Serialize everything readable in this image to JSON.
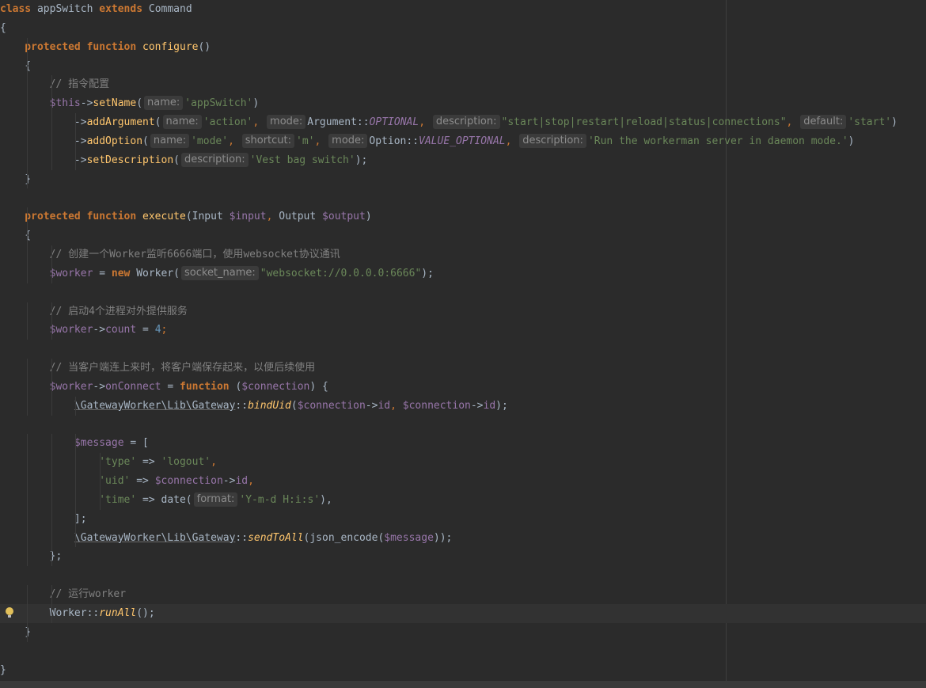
{
  "editor": {
    "lines": [
      [
        {
          "t": "class ",
          "c": "kw"
        },
        {
          "t": "appSwitch ",
          "c": "plain"
        },
        {
          "t": "extends ",
          "c": "kw"
        },
        {
          "t": "Command",
          "c": "plain"
        }
      ],
      [
        {
          "t": "{",
          "c": "plain"
        }
      ],
      [
        {
          "t": "    protected ",
          "c": "kw"
        },
        {
          "t": "function ",
          "c": "kw"
        },
        {
          "t": "configure",
          "c": "fn"
        },
        {
          "t": "()",
          "c": "plain"
        }
      ],
      [
        {
          "t": "    {",
          "c": "plain"
        }
      ],
      [
        {
          "t": "        // 指令配置",
          "c": "cm"
        }
      ],
      [
        {
          "t": "        $this",
          "c": "var"
        },
        {
          "t": "->",
          "c": "plain"
        },
        {
          "t": "setName",
          "c": "fn"
        },
        {
          "t": "(",
          "c": "plain"
        },
        {
          "h": "name:"
        },
        {
          "t": "'appSwitch'",
          "c": "str"
        },
        {
          "t": ")",
          "c": "plain"
        }
      ],
      [
        {
          "t": "            ->",
          "c": "plain"
        },
        {
          "t": "addArgument",
          "c": "fn"
        },
        {
          "t": "(",
          "c": "plain"
        },
        {
          "h": "name:"
        },
        {
          "t": "'action'",
          "c": "str"
        },
        {
          "t": ", ",
          "c": "kwp"
        },
        {
          "h": "mode:"
        },
        {
          "t": "Argument::",
          "c": "plain"
        },
        {
          "t": "OPTIONAL",
          "c": "const"
        },
        {
          "t": ", ",
          "c": "kwp"
        },
        {
          "h": "description:"
        },
        {
          "t": "\"start|stop|restart|reload|status|connections\"",
          "c": "str"
        },
        {
          "t": ", ",
          "c": "kwp"
        },
        {
          "h": "default:"
        },
        {
          "t": "'start'",
          "c": "str"
        },
        {
          "t": ")",
          "c": "plain"
        }
      ],
      [
        {
          "t": "            ->",
          "c": "plain"
        },
        {
          "t": "addOption",
          "c": "fn"
        },
        {
          "t": "(",
          "c": "plain"
        },
        {
          "h": "name:"
        },
        {
          "t": "'mode'",
          "c": "str"
        },
        {
          "t": ", ",
          "c": "kwp"
        },
        {
          "h": "shortcut:"
        },
        {
          "t": "'m'",
          "c": "str"
        },
        {
          "t": ", ",
          "c": "kwp"
        },
        {
          "h": "mode:"
        },
        {
          "t": "Option::",
          "c": "plain"
        },
        {
          "t": "VALUE_OPTIONAL",
          "c": "const"
        },
        {
          "t": ", ",
          "c": "kwp"
        },
        {
          "h": "description:"
        },
        {
          "t": "'Run the workerman server in daemon mode.'",
          "c": "str"
        },
        {
          "t": ")",
          "c": "plain"
        }
      ],
      [
        {
          "t": "            ->",
          "c": "plain"
        },
        {
          "t": "setDescription",
          "c": "fn"
        },
        {
          "t": "(",
          "c": "plain"
        },
        {
          "h": "description:"
        },
        {
          "t": "'Vest bag switch'",
          "c": "str"
        },
        {
          "t": ");",
          "c": "plain"
        }
      ],
      [
        {
          "t": "    }",
          "c": "plain"
        }
      ],
      [],
      [
        {
          "t": "    protected ",
          "c": "kw"
        },
        {
          "t": "function ",
          "c": "kw"
        },
        {
          "t": "execute",
          "c": "fn"
        },
        {
          "t": "(Input ",
          "c": "plain"
        },
        {
          "t": "$input",
          "c": "var"
        },
        {
          "t": ", ",
          "c": "kwp"
        },
        {
          "t": "Output ",
          "c": "plain"
        },
        {
          "t": "$output",
          "c": "var"
        },
        {
          "t": ")",
          "c": "plain"
        }
      ],
      [
        {
          "t": "    {",
          "c": "plain"
        }
      ],
      [
        {
          "t": "        // 创建一个Worker监听6666端口，使用websocket协议通讯",
          "c": "cm"
        }
      ],
      [
        {
          "t": "        $worker",
          "c": "var"
        },
        {
          "t": " = ",
          "c": "plain"
        },
        {
          "t": "new ",
          "c": "kw"
        },
        {
          "t": "Worker(",
          "c": "plain"
        },
        {
          "h": "socket_name:"
        },
        {
          "t": "\"websocket://0.0.0.0:6666\"",
          "c": "str"
        },
        {
          "t": ");",
          "c": "plain"
        }
      ],
      [],
      [
        {
          "t": "        // 启动4个进程对外提供服务",
          "c": "cm"
        }
      ],
      [
        {
          "t": "        $worker",
          "c": "var"
        },
        {
          "t": "->",
          "c": "plain"
        },
        {
          "t": "count",
          "c": "var"
        },
        {
          "t": " = ",
          "c": "plain"
        },
        {
          "t": "4",
          "c": "num"
        },
        {
          "t": ";",
          "c": "kwp"
        }
      ],
      [],
      [
        {
          "t": "        // 当客户端连上来时，将客户端保存起来，以便后续使用",
          "c": "cm"
        }
      ],
      [
        {
          "t": "        $worker",
          "c": "var"
        },
        {
          "t": "->",
          "c": "plain"
        },
        {
          "t": "onConnect",
          "c": "var"
        },
        {
          "t": " = ",
          "c": "plain"
        },
        {
          "t": "function ",
          "c": "kw"
        },
        {
          "t": "(",
          "c": "plain"
        },
        {
          "t": "$connection",
          "c": "var"
        },
        {
          "t": ") {",
          "c": "plain"
        }
      ],
      [
        {
          "t": "            ",
          "c": "plain"
        },
        {
          "t": "\\GatewayWorker\\Lib\\Gateway",
          "c": "ns"
        },
        {
          "t": "::",
          "c": "plain"
        },
        {
          "t": "bindUid",
          "c": "static"
        },
        {
          "t": "(",
          "c": "plain"
        },
        {
          "t": "$connection",
          "c": "var"
        },
        {
          "t": "->",
          "c": "plain"
        },
        {
          "t": "id",
          "c": "var"
        },
        {
          "t": ", ",
          "c": "kwp"
        },
        {
          "t": "$connection",
          "c": "var"
        },
        {
          "t": "->",
          "c": "plain"
        },
        {
          "t": "id",
          "c": "var"
        },
        {
          "t": ");",
          "c": "plain"
        }
      ],
      [],
      [
        {
          "t": "            $message",
          "c": "var"
        },
        {
          "t": " = [",
          "c": "plain"
        }
      ],
      [
        {
          "t": "                'type'",
          "c": "str"
        },
        {
          "t": " => ",
          "c": "plain"
        },
        {
          "t": "'logout'",
          "c": "str"
        },
        {
          "t": ",",
          "c": "kwp"
        }
      ],
      [
        {
          "t": "                'uid'",
          "c": "str"
        },
        {
          "t": " => ",
          "c": "plain"
        },
        {
          "t": "$connection",
          "c": "var"
        },
        {
          "t": "->",
          "c": "plain"
        },
        {
          "t": "id",
          "c": "var"
        },
        {
          "t": ",",
          "c": "kwp"
        }
      ],
      [
        {
          "t": "                'time'",
          "c": "str"
        },
        {
          "t": " => ",
          "c": "plain"
        },
        {
          "t": "date(",
          "c": "plain"
        },
        {
          "h": "format:"
        },
        {
          "t": "'Y-m-d H:i:s'",
          "c": "str"
        },
        {
          "t": "),",
          "c": "plain"
        }
      ],
      [
        {
          "t": "            ];",
          "c": "plain"
        }
      ],
      [
        {
          "t": "            ",
          "c": "plain"
        },
        {
          "t": "\\GatewayWorker\\Lib\\Gateway",
          "c": "ns"
        },
        {
          "t": "::",
          "c": "plain"
        },
        {
          "t": "sendToAll",
          "c": "static"
        },
        {
          "t": "(json_encode(",
          "c": "plain"
        },
        {
          "t": "$message",
          "c": "var"
        },
        {
          "t": "));",
          "c": "plain"
        }
      ],
      [
        {
          "t": "        };",
          "c": "plain"
        }
      ],
      [],
      [
        {
          "t": "        // 运行worker",
          "c": "cm"
        }
      ],
      [
        {
          "t": "        Worker::",
          "c": "plain"
        },
        {
          "t": "runAll",
          "c": "static"
        },
        {
          "t": "();",
          "c": "plain"
        }
      ],
      [
        {
          "t": "    }",
          "c": "plain"
        }
      ],
      [],
      [
        {
          "t": "}",
          "c": "plain"
        }
      ]
    ],
    "current_line": 32,
    "intention_bulb_line": 32
  }
}
